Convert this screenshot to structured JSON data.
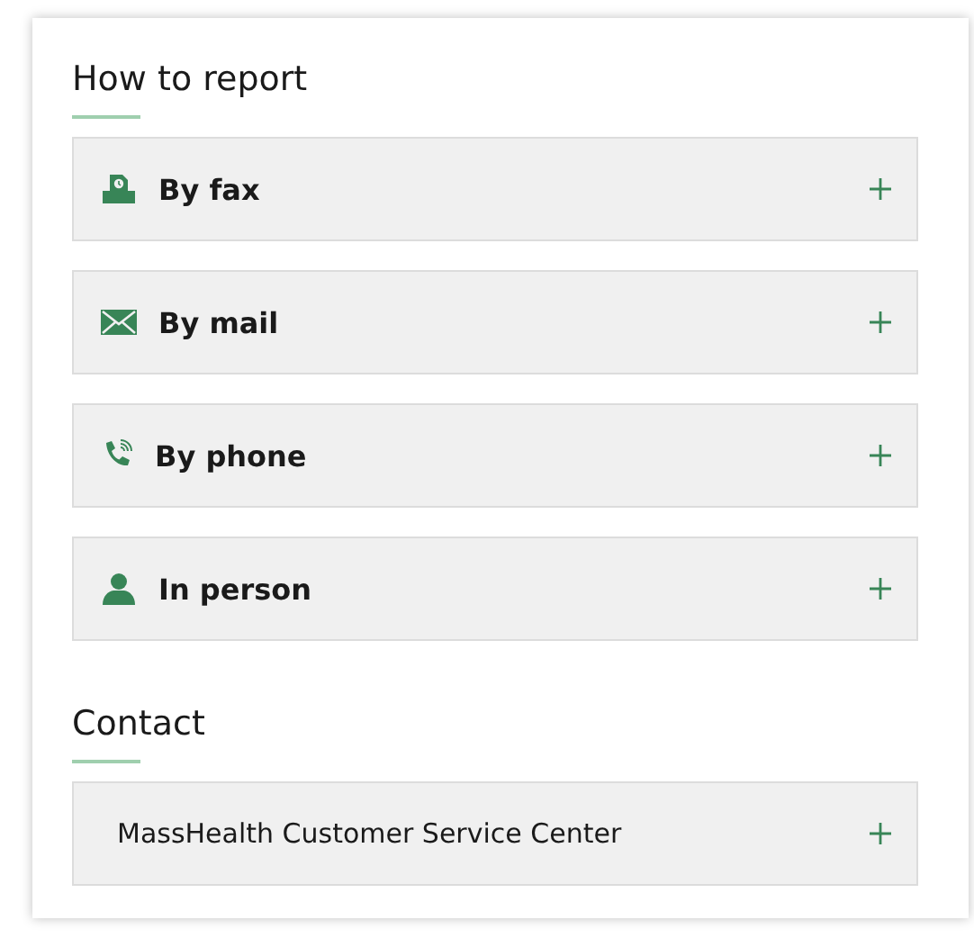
{
  "sections": [
    {
      "title": "How to report",
      "items": [
        {
          "kind": "fax",
          "label": "By fax",
          "expanded": false
        },
        {
          "kind": "mail",
          "label": "By mail",
          "expanded": false
        },
        {
          "kind": "phone",
          "label": "By phone",
          "expanded": false
        },
        {
          "kind": "person",
          "label": "In person",
          "expanded": false
        }
      ]
    },
    {
      "title": "Contact",
      "items": [
        {
          "kind": "plain",
          "label": "MassHealth Customer Service Center",
          "expanded": false
        }
      ]
    }
  ]
}
